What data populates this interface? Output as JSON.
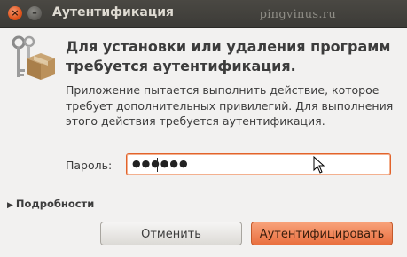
{
  "window": {
    "title": "Аутентификация",
    "watermark": "pingvinus.ru",
    "close_symbol": "×",
    "minimize_symbol": "–"
  },
  "dialog": {
    "heading": "Для установки или удаления программ требуется аутентификация.",
    "message": "Приложение пытается выполнить действие, которое требует дополнительных привилегий. Для выполнения этого действия требуется аутентификация.",
    "password": {
      "label": "Пароль:",
      "masked_value": "●●●●●●"
    },
    "details": {
      "arrow": "▶",
      "label": "Подробности"
    },
    "buttons": {
      "cancel": "Отменить",
      "authenticate": "Аутентифицировать"
    }
  },
  "icons": {
    "dialog_icon": "keys-and-package-icon",
    "pointer": "mouse-cursor-icon"
  },
  "colors": {
    "accent": "#e96f3f",
    "titlebar": "#3c3b37"
  }
}
